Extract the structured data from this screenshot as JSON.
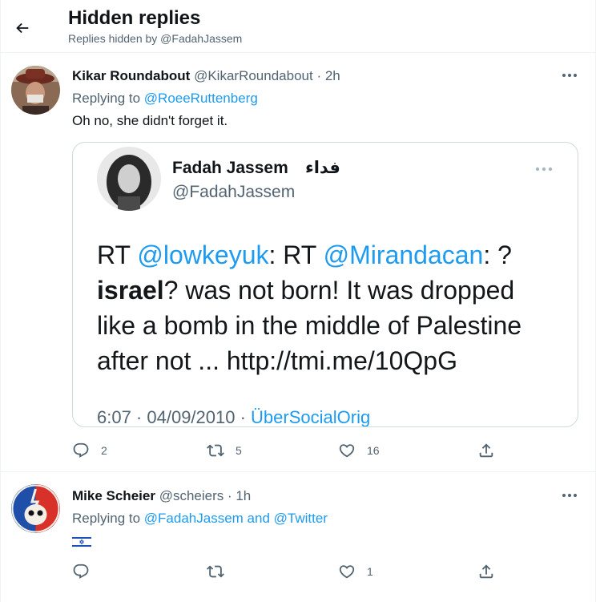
{
  "header": {
    "title": "Hidden replies",
    "subtitle": "Replies hidden by @FadahJassem"
  },
  "tweets": [
    {
      "display_name": "Kikar Roundabout",
      "handle": "@KikarRoundabout",
      "time": " · 2h",
      "replying_prefix": "Replying to ",
      "replying_to": "@RoeeRuttenberg",
      "text": "Oh no, she didn't forget it.",
      "embedded": {
        "name": "Fadah Jassem",
        "arabic_name": "فداء",
        "handle": "@FadahJassem",
        "rt1": "RT ",
        "mention1": "@lowkeyuk",
        "rt2": ": RT ",
        "mention2": "@Mirandacan",
        "rt3": ": ?",
        "bold_word": "israel",
        "line2_rest": "? was not born! It was dropped",
        "line3": "like a bomb in the middle of Palestine",
        "line4_prefix": "after not ... ",
        "line4_link": "http://tmi.me/10QpG",
        "footer_time": "6:07 · 04/09/2010 · ",
        "footer_source": "ÜberSocialOrig"
      },
      "counts": {
        "replies": "2",
        "retweets": "5",
        "likes": "16"
      }
    },
    {
      "display_name": "Mike Scheier",
      "handle": "@scheiers",
      "time": " · 1h",
      "replying_prefix": "Replying to ",
      "replying_to": "@FadahJassem and @Twitter",
      "flag": "israel-flag",
      "counts": {
        "replies": "",
        "retweets": "",
        "likes": "1"
      }
    }
  ],
  "colors": {
    "accent": "#1d9bf0",
    "secondary_text": "#536471",
    "border": "#eff3f4"
  }
}
